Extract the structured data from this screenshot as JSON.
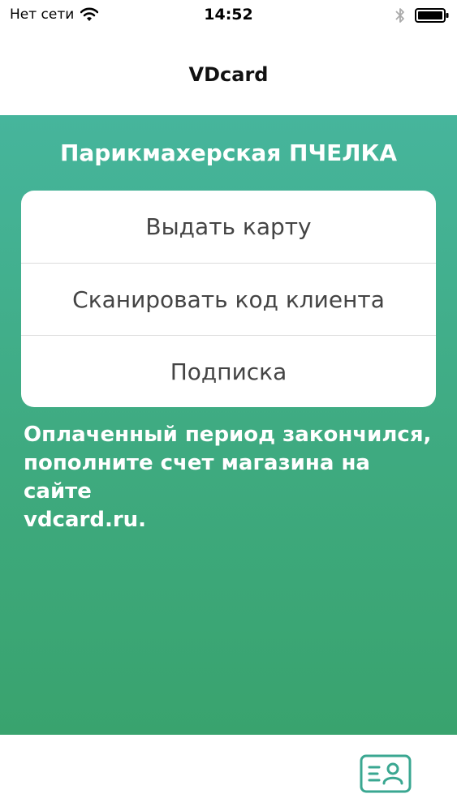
{
  "status_bar": {
    "carrier": "Нет сети",
    "time": "14:52",
    "icons": [
      "wifi-icon",
      "bluetooth-icon",
      "battery-icon"
    ]
  },
  "nav": {
    "title": "VDcard"
  },
  "main": {
    "shop_title": "Парикмахерская ПЧЕЛКА",
    "menu": [
      {
        "label": "Выдать карту"
      },
      {
        "label": "Сканировать код клиента"
      },
      {
        "label": "Подписка"
      }
    ],
    "notice": "Оплаченный период закончился,\nпополните счет магазина на сайте\nvdcard.ru."
  },
  "tab_bar": {
    "icon": "client-card-icon"
  },
  "colors": {
    "accent": "#3fab82",
    "gradient_top": "#46b59c",
    "gradient_bottom": "#39a36e",
    "icon_teal": "#3aa791",
    "menu_text": "#444444"
  }
}
